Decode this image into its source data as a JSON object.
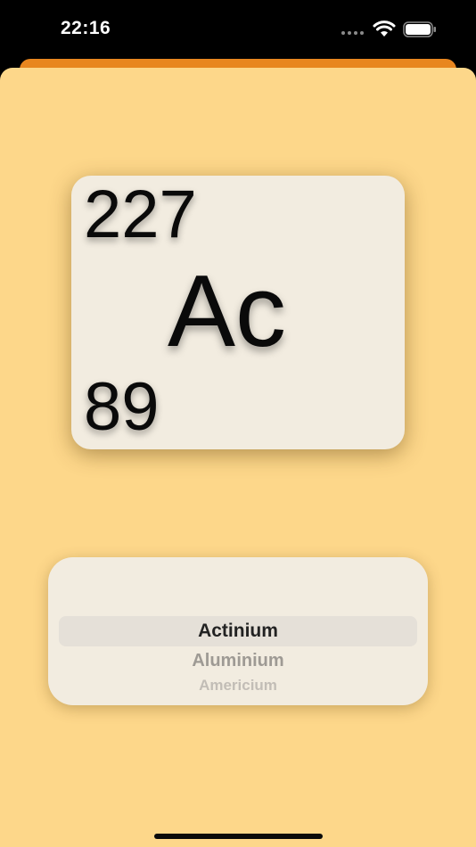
{
  "status_bar": {
    "time": "22:16",
    "wifi_icon": "wifi-icon",
    "battery_icon": "battery-icon"
  },
  "element": {
    "atomic_mass": "227",
    "symbol": "Ac",
    "atomic_number": "89"
  },
  "picker": {
    "selected": "Actinium",
    "next": "Aluminium",
    "next2": "Americium"
  },
  "colors": {
    "background": "#fdd78a",
    "accent": "#e8861f",
    "card": "#f2ece0"
  }
}
